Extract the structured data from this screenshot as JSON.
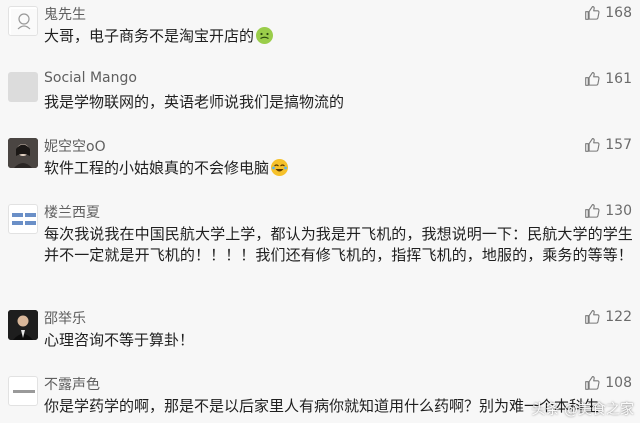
{
  "comments": [
    {
      "name": "鬼先生",
      "likes": "168",
      "text": "大哥，电子商务不是淘宝开店的",
      "emoji": "nauseated-emoji"
    },
    {
      "name": "Social Mango",
      "likes": "161",
      "text": "我是学物联网的，英语老师说我们是搞物流的"
    },
    {
      "name": "妮空空oO",
      "likes": "157",
      "text": "软件工程的小姑娘真的不会修电脑",
      "emoji": "crying-laughing-emoji"
    },
    {
      "name": "楼兰西夏",
      "likes": "130",
      "text": "每次我说我在中国民航大学上学，都认为我是开飞机的，我想说明一下：民航大学的学生并不一定就是开飞机的！！！！我们还有修飞机的，指挥飞机的，地服的，乘务的等等！"
    },
    {
      "name": "邵举乐",
      "likes": "122",
      "text": "心理咨询不等于算卦！"
    },
    {
      "name": "不露声色",
      "likes": "108",
      "text": "你是学药学的啊，那是不是以后家里人有病你就知道用什么药啊？别为难一个本科生"
    }
  ],
  "watermark": "头条 @美食之家"
}
